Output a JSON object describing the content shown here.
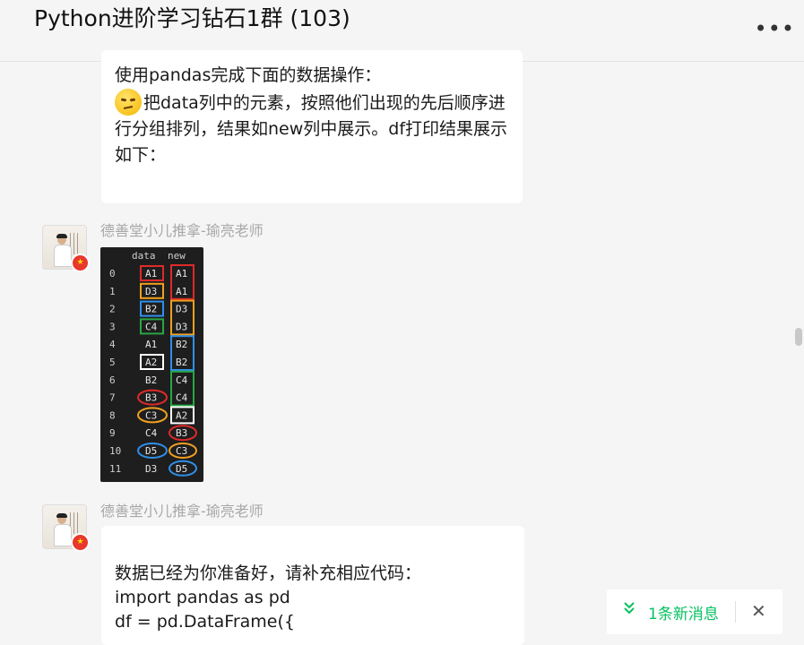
{
  "window": {
    "title": "Python进阶学习钻石1群 (103)",
    "more_label": "•••"
  },
  "messages": [
    {
      "type": "text",
      "lines_before_emoji": "使用pandas完成下面的数据操作：",
      "emoji": "thinking-face",
      "line_after_emoji": "把data列中的元素，按照他们出现的先后顺序进行分组排列，结果如new列中展示。df打印结果展示如下："
    },
    {
      "type": "image",
      "sender": "德善堂小儿推拿-瑜亮老师",
      "image": {
        "header": [
          "data",
          "new"
        ],
        "index": [
          "0",
          "1",
          "2",
          "3",
          "4",
          "5",
          "6",
          "7",
          "8",
          "9",
          "10",
          "11"
        ],
        "data_col": [
          "A1",
          "D3",
          "B2",
          "C4",
          "A1",
          "A2",
          "B2",
          "B3",
          "C3",
          "C4",
          "D5",
          "D3"
        ],
        "new_col": [
          "A1",
          "A1",
          "D3",
          "D3",
          "B2",
          "B2",
          "C4",
          "C4",
          "A2",
          "B3",
          "C3",
          "D5"
        ],
        "colors": {
          "red": "#e02a2a",
          "orange": "#f0a020",
          "blue": "#2f8fe8",
          "green": "#28a745",
          "white": "#ffffff"
        }
      }
    },
    {
      "type": "text",
      "sender": "德善堂小儿推拿-瑜亮老师",
      "code": "数据已经为你准备好，请补充相应代码：\nimport pandas as pd\ndf = pd.DataFrame({"
    }
  ],
  "new_message_bar": {
    "label": "1条新消息",
    "icon": "double-chevron-down-icon",
    "close_icon": "close-icon",
    "accent": "#07c160"
  }
}
